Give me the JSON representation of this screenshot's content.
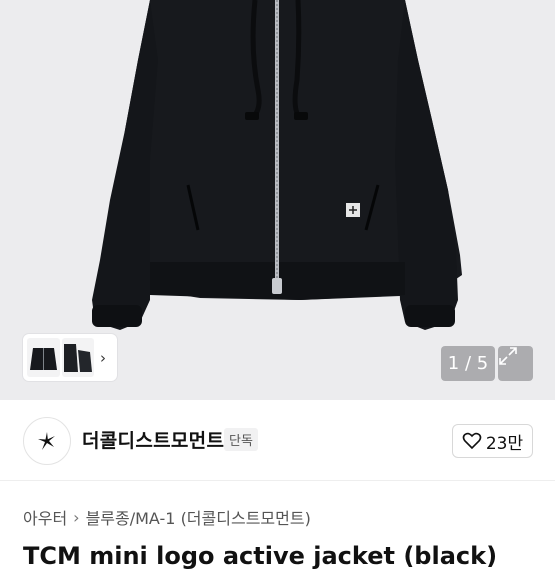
{
  "gallery": {
    "counter": "1 / 5"
  },
  "seller": {
    "name": "더콜디스트모먼트",
    "badge": "단독",
    "likes": "23만"
  },
  "breadcrumb": {
    "category": "아우터",
    "subcategory": "블루종/MA-1 (더콜디스트모먼트)"
  },
  "product": {
    "title": "TCM mini logo active jacket (black)"
  },
  "colors": {
    "hero_bg": "#ececee",
    "jacket": "#17191d"
  }
}
